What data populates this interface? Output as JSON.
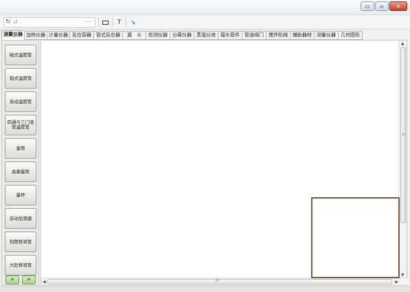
{
  "window": {
    "controls": {
      "minimize": "▭",
      "maximize": "▫",
      "close": "✕"
    }
  },
  "toolbar": {
    "combo_text": "——",
    "text_tool": "T",
    "arrow_tool": "↘"
  },
  "tabs": [
    "测量仪器",
    "加热仪器",
    "计量仪器",
    "反应容器",
    "管式反应器",
    "漏　斗",
    "检测仪器",
    "分离仪器",
    "蒸馏分液",
    "接头管件",
    "管道阀门",
    "搅拌机械",
    "辅助器材",
    "测量仪器",
    "几何图形"
  ],
  "left_buttons": [
    "磁式温度管",
    "指式温度管",
    "自动温度管",
    "四通与三门液管温度管",
    "量筒",
    "具塞量筒",
    "量杯",
    "自动加液器",
    "刻度移液管",
    "大肚移液管"
  ],
  "nav": {
    "prev": "«",
    "next": "»"
  },
  "scroll": {
    "up": "▲",
    "down": "▼",
    "left": "◀",
    "right": "▶",
    "grip_v": "≡",
    "grip_h": "III"
  },
  "icons": [
    "app-icon",
    "undo-icon",
    "rectangle-icon",
    "text-icon",
    "arrow-line-icon",
    "minimize-icon",
    "maximize-icon",
    "close-icon",
    "prev-icon",
    "next-icon"
  ]
}
